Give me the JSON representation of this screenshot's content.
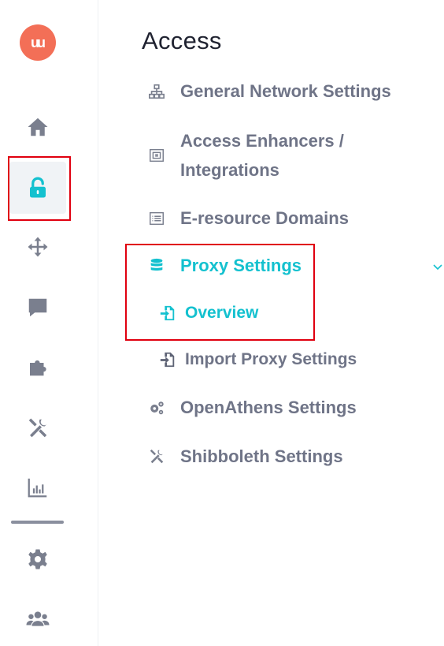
{
  "logo": {
    "text": "u"
  },
  "rail": {
    "items": [
      {
        "name": "home",
        "icon": "home-icon"
      },
      {
        "name": "access",
        "icon": "lock-open-icon",
        "active": true
      },
      {
        "name": "arrows",
        "icon": "move-arrows-icon"
      },
      {
        "name": "messages",
        "icon": "chat-bubble-icon"
      },
      {
        "name": "integrations",
        "icon": "puzzle-icon"
      },
      {
        "name": "tools",
        "icon": "tools-icon"
      },
      {
        "name": "analytics",
        "icon": "bar-chart-icon"
      },
      {
        "name": "settings",
        "icon": "gear-icon"
      },
      {
        "name": "users",
        "icon": "users-icon"
      }
    ]
  },
  "colors": {
    "accent": "#14c1cf",
    "text_muted": "#6f7487",
    "heading": "#1f2230",
    "logo_bg": "#f36f57",
    "highlight": "#e0000f"
  },
  "section": {
    "title": "Access"
  },
  "menu": {
    "general_network": "General Network Settings",
    "access_enhancers": "Access Enhancers / Integrations",
    "eresource_domains": "E-resource Domains",
    "proxy_settings": "Proxy Settings",
    "overview": "Overview",
    "import_proxy": "Import Proxy Settings",
    "openathens": "OpenAthens Settings",
    "shibboleth": "Shibboleth Settings"
  }
}
